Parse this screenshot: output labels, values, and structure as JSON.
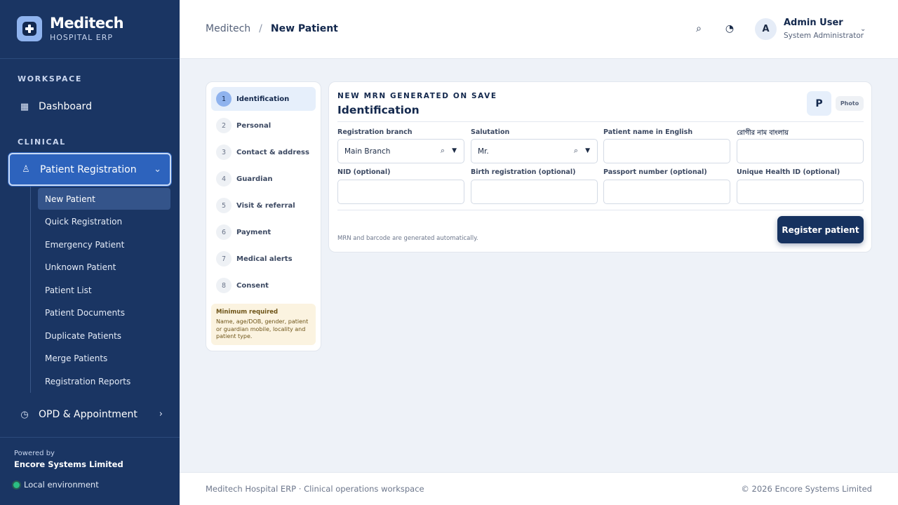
{
  "brand": {
    "name": "Meditech",
    "subtitle": "HOSPITAL ERP"
  },
  "sidebar": {
    "sections": {
      "workspace": "WORKSPACE",
      "clinical": "CLINICAL"
    },
    "dashboard": {
      "label": "Dashboard",
      "icon": "grid-icon"
    },
    "patient_registration": {
      "label": "Patient Registration",
      "icon": "person-icon",
      "expanded": true,
      "items": [
        {
          "label": "New Patient",
          "active": true
        },
        {
          "label": "Quick Registration"
        },
        {
          "label": "Emergency Patient"
        },
        {
          "label": "Unknown Patient"
        },
        {
          "label": "Patient List"
        },
        {
          "label": "Patient Documents"
        },
        {
          "label": "Duplicate Patients"
        },
        {
          "label": "Merge Patients"
        },
        {
          "label": "Registration Reports"
        }
      ]
    },
    "opd": {
      "label": "OPD & Appointment",
      "icon": "clock-icon"
    },
    "footer": {
      "powered_by": "Powered by",
      "company": "Encore Systems Limited",
      "environment": "Local environment",
      "env_color": "#2bbf84"
    }
  },
  "header": {
    "breadcrumb": {
      "root": "Meditech",
      "separator": "/",
      "current": "New Patient"
    },
    "search_icon": "search-icon",
    "theme_icon": "theme-toggle-icon",
    "user": {
      "initial": "A",
      "name": "Admin User",
      "role": "System Administrator"
    }
  },
  "steps": {
    "items": [
      {
        "num": "1",
        "label": "Identification",
        "active": true
      },
      {
        "num": "2",
        "label": "Personal"
      },
      {
        "num": "3",
        "label": "Contact & address"
      },
      {
        "num": "4",
        "label": "Guardian"
      },
      {
        "num": "5",
        "label": "Visit & referral"
      },
      {
        "num": "6",
        "label": "Payment"
      },
      {
        "num": "7",
        "label": "Medical alerts"
      },
      {
        "num": "8",
        "label": "Consent"
      }
    ],
    "minimum": {
      "title": "Minimum required",
      "text": "Name, age/DOB, gender, patient or guardian mobile, locality and patient type."
    }
  },
  "form": {
    "eyebrow": "NEW MRN GENERATED ON SAVE",
    "title": "Identification",
    "photo_initial": "P",
    "photo_label": "Photo",
    "fields": {
      "branch": {
        "label": "Registration branch",
        "value": "Main Branch"
      },
      "salutation": {
        "label": "Salutation",
        "value": "Mr."
      },
      "name_en": {
        "label": "Patient name in English",
        "value": ""
      },
      "name_bn": {
        "label": "রোগীর নাম বাংলায়",
        "value": ""
      },
      "nid": {
        "label": "NID (optional)",
        "value": ""
      },
      "birth_reg": {
        "label": "Birth registration (optional)",
        "value": ""
      },
      "passport": {
        "label": "Passport number (optional)",
        "value": ""
      },
      "uhid": {
        "label": "Unique Health ID (optional)",
        "value": ""
      }
    },
    "note": "MRN and barcode are generated automatically.",
    "submit": "Register patient",
    "accent": "#16325f"
  },
  "footer": {
    "left": "Meditech Hospital ERP · Clinical operations workspace",
    "right": "© 2026 Encore Systems Limited"
  }
}
